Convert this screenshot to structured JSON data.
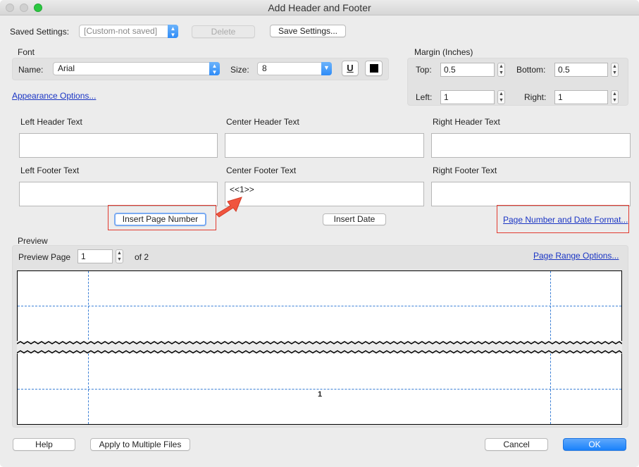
{
  "window": {
    "title": "Add Header and Footer"
  },
  "saved_settings": {
    "label": "Saved Settings:",
    "value": "[Custom-not saved]",
    "delete_label": "Delete",
    "save_label": "Save Settings..."
  },
  "font": {
    "section_label": "Font",
    "name_label": "Name:",
    "name_value": "Arial",
    "size_label": "Size:",
    "size_value": "8",
    "underline_glyph": "U",
    "color": "#000000"
  },
  "margin": {
    "section_label": "Margin (Inches)",
    "top_label": "Top:",
    "top_value": "0.5",
    "bottom_label": "Bottom:",
    "bottom_value": "0.5",
    "left_label": "Left:",
    "left_value": "1",
    "right_label": "Right:",
    "right_value": "1"
  },
  "appearance_link": "Appearance Options...",
  "text_fields": {
    "left_header_label": "Left Header Text",
    "center_header_label": "Center Header Text",
    "right_header_label": "Right Header Text",
    "left_footer_label": "Left Footer Text",
    "center_footer_label": "Center Footer Text",
    "right_footer_label": "Right Footer Text",
    "left_header_value": "",
    "center_header_value": "",
    "right_header_value": "",
    "left_footer_value": "",
    "center_footer_value": "<<1>>",
    "right_footer_value": ""
  },
  "actions": {
    "insert_page_number": "Insert Page Number",
    "insert_date": "Insert Date",
    "page_number_date_format": "Page Number and Date Format..."
  },
  "preview": {
    "section_label": "Preview",
    "page_label": "Preview Page",
    "page_value": "1",
    "of_label": "of 2",
    "page_range_link": "Page Range Options...",
    "footer_number": "1"
  },
  "footer_buttons": {
    "help": "Help",
    "apply_multiple": "Apply to Multiple Files",
    "cancel": "Cancel",
    "ok": "OK"
  },
  "colors": {
    "accent": "#1a82fb",
    "highlight_box": "#e23a2f",
    "arrow": "#f0553f",
    "guide_lines": "#3a7fd6",
    "link": "#1a35c4"
  }
}
